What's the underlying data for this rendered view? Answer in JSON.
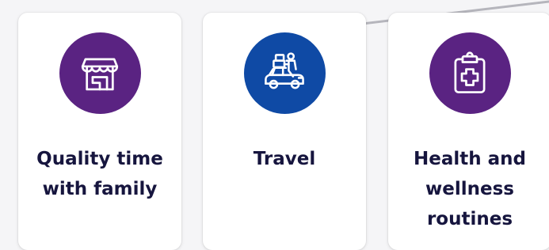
{
  "cards": [
    {
      "title": "Quality time\nwith family",
      "icon": "storefront-icon",
      "color": "#5a2382"
    },
    {
      "title": "Travel",
      "icon": "car-luggage-icon",
      "color": "#0f4aa5"
    },
    {
      "title": "Health and\nwellness\nroutines",
      "icon": "medical-clipboard-icon",
      "color": "#5a2382"
    }
  ],
  "colors": {
    "page_background": "#f5f5f7",
    "card_background": "#ffffff",
    "text": "#16153e",
    "scroll_line": "#b5b5bc"
  }
}
